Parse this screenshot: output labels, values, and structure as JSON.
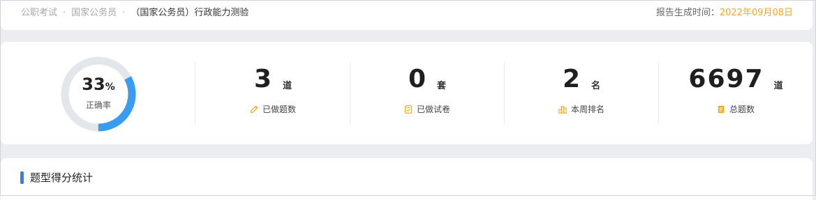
{
  "breadcrumb": {
    "items": [
      "公职考试",
      "国家公务员"
    ],
    "separator": "·",
    "current": "（国家公务员）行政能力测验"
  },
  "report": {
    "label": "报告生成时间：",
    "date": "2022年09月08日"
  },
  "accuracy": {
    "value": "33",
    "unit": "%",
    "label": "正确率",
    "fraction": 0.33
  },
  "stats": [
    {
      "value": "3",
      "unit": "道",
      "label": "已做题数",
      "icon": "pencil-icon"
    },
    {
      "value": "0",
      "unit": "套",
      "label": "已做试卷",
      "icon": "exam-paper-icon"
    },
    {
      "value": "2",
      "unit": "名",
      "label": "本周排名",
      "icon": "ranking-chart-icon"
    },
    {
      "value": "6697",
      "unit": "道",
      "label": "总题数",
      "icon": "document-icon"
    }
  ],
  "section": {
    "title": "题型得分统计"
  },
  "colors": {
    "accent": "#f5a623",
    "ring_progress": "#3a9cf0",
    "ring_track": "#e3e6ea",
    "section_bar": "#2f80ed"
  }
}
